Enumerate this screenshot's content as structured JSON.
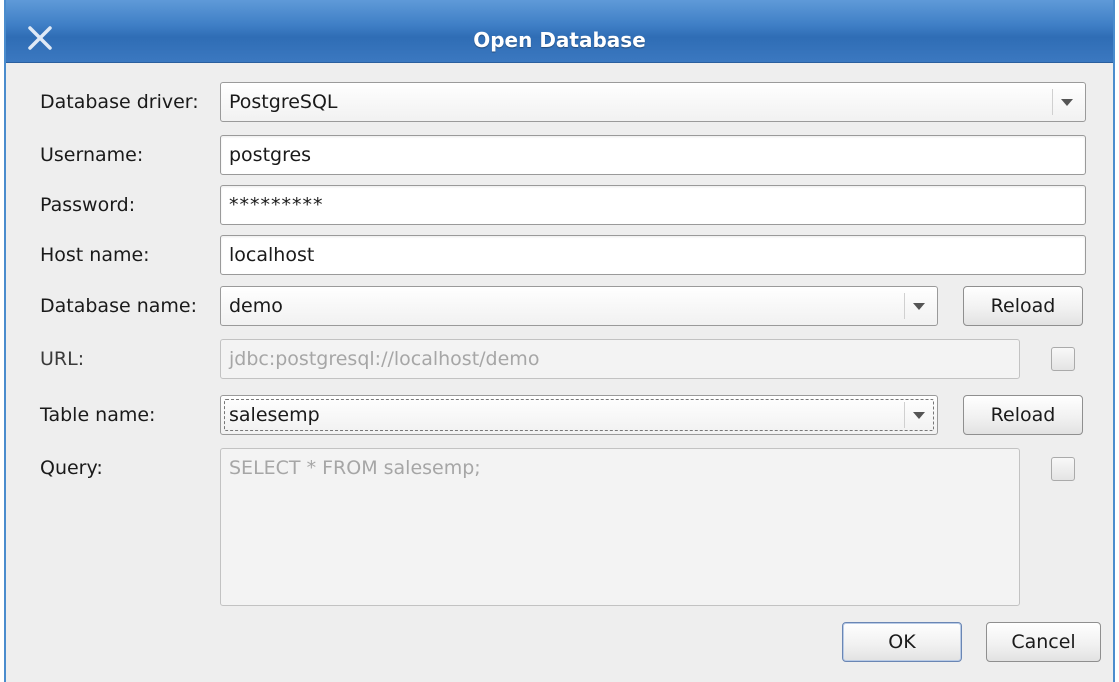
{
  "window": {
    "title": "Open Database"
  },
  "form": {
    "driver": {
      "label": "Database driver:",
      "value": "PostgreSQL"
    },
    "username": {
      "label": "Username:",
      "value": "postgres"
    },
    "password": {
      "label": "Password:",
      "value": "*********"
    },
    "host": {
      "label": "Host name:",
      "value": "localhost"
    },
    "database": {
      "label": "Database name:",
      "value": "demo",
      "reload_label": "Reload"
    },
    "url": {
      "label": "URL:",
      "value": "jdbc:postgresql://localhost/demo"
    },
    "table": {
      "label": "Table name:",
      "value": "salesemp",
      "reload_label": "Reload"
    },
    "query": {
      "label": "Query:",
      "value": "SELECT * FROM salesemp;"
    }
  },
  "buttons": {
    "ok_label": "OK",
    "cancel_label": "Cancel"
  },
  "icons": {
    "close": "close-icon",
    "dropdown": "chevron-down-icon"
  },
  "colors": {
    "titlebar": "#3f7fc6",
    "window_bg": "#eeeeee"
  }
}
